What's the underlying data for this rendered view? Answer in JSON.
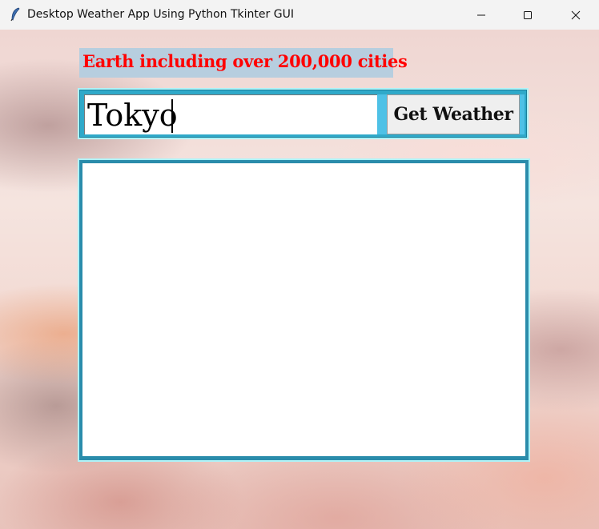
{
  "window": {
    "title": "Desktop Weather App Using Python Tkinter GUI",
    "icon": "feather-icon",
    "controls": [
      "minimize-icon",
      "maximize-icon",
      "close-icon"
    ]
  },
  "header": {
    "text": "Earth including over 200,000 cities"
  },
  "search": {
    "value": "Tokyo",
    "button_label": "Get Weather"
  },
  "output": {
    "text": ""
  },
  "colors": {
    "headline_text": "#ff0000",
    "headline_bg": "#b7cedf",
    "frame": "#2fa9c9",
    "frame_glow": "#aef3f8"
  }
}
